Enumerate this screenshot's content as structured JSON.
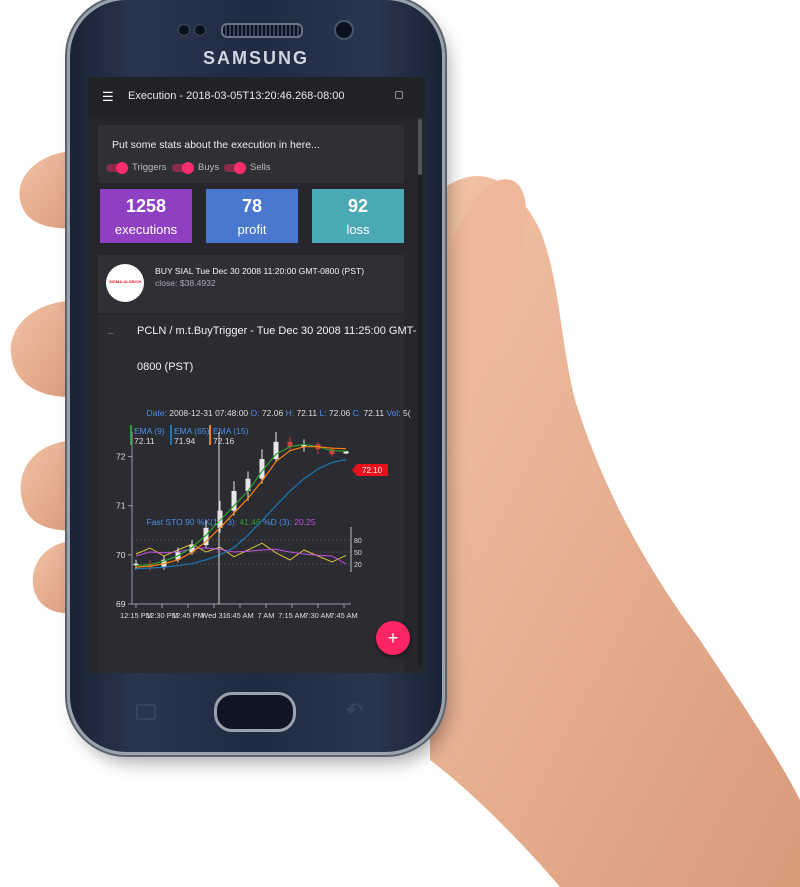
{
  "colors": {
    "accent": "#ff2d6f",
    "executions_tile": "#8e3fc2",
    "profit_tile": "#4a78cf",
    "loss_tile": "#4aa9b4",
    "screen_bg": "#26262c"
  },
  "device": {
    "brand": "SAMSUNG"
  },
  "appbar": {
    "menu_icon": "menu-icon",
    "title": "Execution - 2018-03-05T13:20:46.268-08:00"
  },
  "stats": {
    "description": "Put some stats about the execution in here...",
    "toggles": [
      {
        "label": "Triggers",
        "on": true
      },
      {
        "label": "Buys",
        "on": true
      },
      {
        "label": "Sells",
        "on": true
      }
    ],
    "tiles": [
      {
        "value": "1258",
        "caption": "executions"
      },
      {
        "value": "78",
        "caption": "profit"
      },
      {
        "value": "92",
        "caption": "loss"
      }
    ]
  },
  "event": {
    "logo_text": "SIGMA-ALDRICH",
    "title": "BUY SIAL Tue Dec 30 2008 11:20:00 GMT-0800 (PST)",
    "subtitle": "close: $38.4932"
  },
  "detail": {
    "line1": "PCLN / m.t.BuyTrigger - Tue Dec 30 2008 11:25:00 GMT-",
    "line2": "0800 (PST)"
  },
  "chart_data": {
    "type": "line",
    "tooltip": {
      "date_label": "Date:",
      "date_value": "2008-12-31 07:48:00",
      "o_label": "O:",
      "o_value": "72.06",
      "h_label": "H:",
      "h_value": "72.11",
      "l_label": "L:",
      "l_value": "72.06",
      "c_label": "C:",
      "c_value": "72.11",
      "vol_label": "Vol:",
      "vol_value": "5("
    },
    "legend": [
      {
        "name": "EMA (9)",
        "value": "72.11",
        "color": "#2ca02c"
      },
      {
        "name": "EMA (65)",
        "value": "71.94",
        "color": "#1f77b4"
      },
      {
        "name": "EMA (15)",
        "value": "72.16",
        "color": "#ff7f0e"
      }
    ],
    "last_price": "72.10",
    "y_ticks": [
      "72",
      "71",
      "70",
      "69"
    ],
    "ylim": [
      69,
      72.5
    ],
    "x_ticks": [
      "12:15 PM",
      "12:30 PM",
      "12:45 PM",
      "Wed 31",
      "6:45 AM",
      "7 AM",
      "7:15 AM",
      "7:30 AM",
      "7:45 AM"
    ],
    "stochastic": {
      "label": "Fast STO 90 %K(14, 3):",
      "k_value": "41.46",
      "d_label": "%D (3):",
      "d_value": "20.25",
      "levels": [
        "80",
        "50",
        "20"
      ]
    },
    "series": [
      {
        "name": "EMA (9)",
        "values": [
          69.78,
          69.8,
          69.87,
          69.98,
          70.15,
          70.4,
          70.7,
          71.0,
          71.3,
          71.7,
          72.05,
          72.2,
          72.25,
          72.2,
          72.12,
          72.11
        ]
      },
      {
        "name": "EMA (15)",
        "values": [
          69.75,
          69.77,
          69.82,
          69.9,
          70.05,
          70.27,
          70.55,
          70.85,
          71.15,
          71.5,
          71.9,
          72.12,
          72.2,
          72.2,
          72.17,
          72.16
        ]
      },
      {
        "name": "EMA (65)",
        "values": [
          69.72,
          69.73,
          69.75,
          69.78,
          69.82,
          69.9,
          70.0,
          70.15,
          70.4,
          70.7,
          71.0,
          71.3,
          71.55,
          71.75,
          71.88,
          71.94
        ]
      }
    ],
    "candles": [
      {
        "o": 69.8,
        "c": 69.82,
        "h": 69.9,
        "l": 69.7
      },
      {
        "o": 69.82,
        "c": 69.75,
        "h": 69.9,
        "l": 69.68
      },
      {
        "o": 69.75,
        "c": 69.9,
        "h": 69.98,
        "l": 69.7
      },
      {
        "o": 69.9,
        "c": 70.05,
        "h": 70.15,
        "l": 69.85
      },
      {
        "o": 70.05,
        "c": 70.2,
        "h": 70.3,
        "l": 70.0
      },
      {
        "o": 70.2,
        "c": 70.55,
        "h": 70.7,
        "l": 70.15
      },
      {
        "o": 70.55,
        "c": 70.9,
        "h": 71.1,
        "l": 70.45
      },
      {
        "o": 70.9,
        "c": 71.3,
        "h": 71.5,
        "l": 70.8
      },
      {
        "o": 71.3,
        "c": 71.55,
        "h": 71.7,
        "l": 71.1
      },
      {
        "o": 71.55,
        "c": 71.95,
        "h": 72.15,
        "l": 71.45
      },
      {
        "o": 71.95,
        "c": 72.3,
        "h": 72.5,
        "l": 71.9
      },
      {
        "o": 72.3,
        "c": 72.2,
        "h": 72.4,
        "l": 72.1
      },
      {
        "o": 72.2,
        "c": 72.25,
        "h": 72.35,
        "l": 72.1
      },
      {
        "o": 72.25,
        "c": 72.15,
        "h": 72.3,
        "l": 72.05
      },
      {
        "o": 72.15,
        "c": 72.05,
        "h": 72.2,
        "l": 72.0
      },
      {
        "o": 72.06,
        "c": 72.11,
        "h": 72.11,
        "l": 72.06
      }
    ],
    "sto_k": [
      45,
      60,
      40,
      55,
      70,
      50,
      62,
      38,
      55,
      72,
      48,
      30,
      55,
      40,
      25,
      41.46
    ],
    "sto_d": [
      40,
      50,
      48,
      50,
      58,
      60,
      57,
      50,
      52,
      55,
      57,
      50,
      45,
      42,
      40,
      20.25
    ]
  },
  "fab": {
    "label": "+"
  }
}
